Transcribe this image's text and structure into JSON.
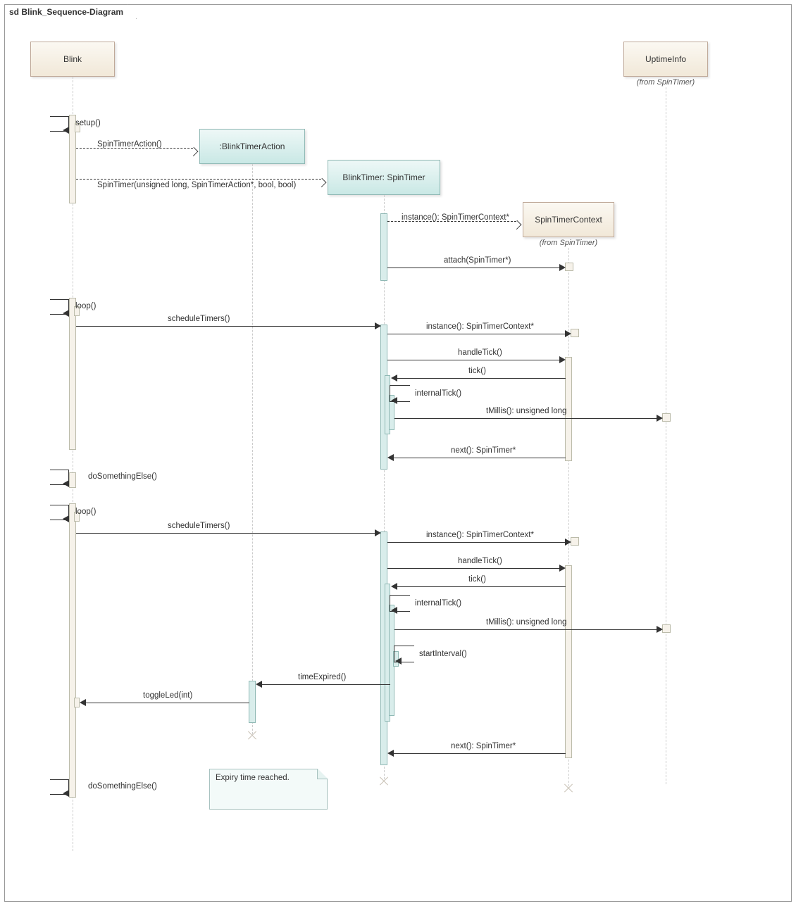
{
  "frame_title": "sd Blink_Sequence-Diagram",
  "lifelines": {
    "blink": "Blink",
    "blinkTimerAction": ":BlinkTimerAction",
    "blinkTimer": "BlinkTimer: SpinTimer",
    "spinTimerContext": "SpinTimerContext",
    "spinTimerContext_sub": "(from SpinTimer)",
    "uptimeInfo": "UptimeInfo",
    "uptimeInfo_sub": "(from SpinTimer)"
  },
  "messages": {
    "setup": "setup()",
    "spinTimerAction": "SpinTimerAction()",
    "spinTimer": "SpinTimer(unsigned long, SpinTimerAction*, bool, bool)",
    "instance": "instance(): SpinTimerContext*",
    "attach": "attach(SpinTimer*)",
    "loop": "loop()",
    "scheduleTimers": "scheduleTimers()",
    "handleTick": "handleTick()",
    "tick": "tick()",
    "internalTick": "internalTick()",
    "tMillis": "tMillis(): unsigned long",
    "next": "next(): SpinTimer*",
    "doSomethingElse": "doSomethingElse()",
    "startInterval": "startInterval()",
    "timeExpired": "timeExpired()",
    "toggleLed": "toggleLed(int)"
  },
  "note": "Expiry time reached."
}
